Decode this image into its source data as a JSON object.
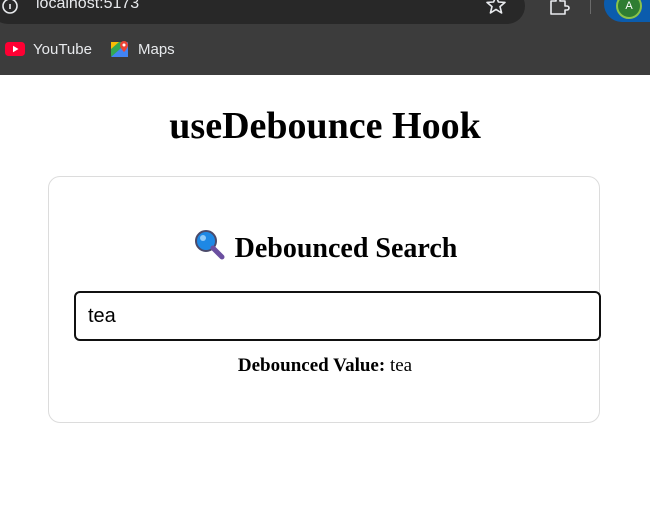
{
  "browser": {
    "url": "localhost:5173",
    "profile_initial": "A",
    "bookmarks": [
      {
        "label": "YouTube",
        "icon": "youtube-icon"
      },
      {
        "label": "Maps",
        "icon": "maps-icon"
      }
    ]
  },
  "page": {
    "title": "useDebounce Hook",
    "card": {
      "heading": "Debounced Search",
      "heading_icon": "magnifying-glass-icon",
      "search_value": "tea",
      "debounced_label": "Debounced Value:",
      "debounced_value": "tea"
    }
  },
  "colors": {
    "chrome_bg": "#3c3c3c",
    "omnibox_bg": "#282828",
    "profile_bg": "#0b5cad",
    "card_border": "#dcdcdc"
  }
}
